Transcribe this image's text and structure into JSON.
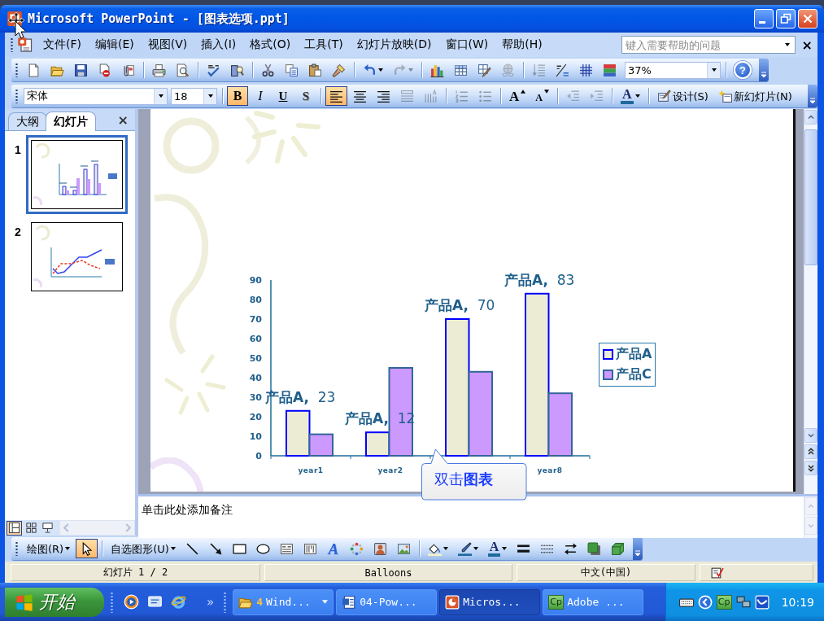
{
  "window": {
    "title": "Microsoft PowerPoint - [图表选项.ppt]"
  },
  "menu_bar": {
    "items": [
      "文件(F)",
      "编辑(E)",
      "视图(V)",
      "插入(I)",
      "格式(O)",
      "工具(T)",
      "幻灯片放映(D)",
      "窗口(W)",
      "帮助(H)"
    ],
    "help_box": {
      "placeholder": "键入需要帮助的问题"
    },
    "close": "×"
  },
  "standard_toolbar": {
    "groups": [
      [
        {
          "kind": "new",
          "disabled": false
        },
        {
          "kind": "open",
          "disabled": false
        },
        {
          "kind": "save",
          "disabled": false
        },
        {
          "kind": "permission",
          "disabled": false
        },
        {
          "kind": "email",
          "disabled": false
        }
      ],
      [
        {
          "kind": "print",
          "disabled": false
        },
        {
          "kind": "preview",
          "disabled": false
        }
      ],
      [
        {
          "kind": "spelling",
          "disabled": false
        },
        {
          "kind": "research",
          "disabled": false
        }
      ],
      [
        {
          "kind": "cut",
          "disabled": false
        },
        {
          "kind": "copy",
          "disabled": false
        },
        {
          "kind": "paste",
          "disabled": false
        },
        {
          "kind": "painter",
          "disabled": false
        }
      ],
      [
        {
          "kind": "undo",
          "disabled": false,
          "dropdown": true
        },
        {
          "kind": "redo",
          "disabled": true,
          "dropdown": true
        }
      ],
      [
        {
          "kind": "chart",
          "disabled": false
        },
        {
          "kind": "table",
          "disabled": false
        },
        {
          "kind": "tables_borders",
          "disabled": false
        },
        {
          "kind": "hyperlink",
          "disabled": true
        }
      ],
      [
        {
          "kind": "expand",
          "disabled": true
        },
        {
          "kind": "formatting",
          "disabled": false
        },
        {
          "kind": "grid",
          "disabled": false
        },
        {
          "kind": "color",
          "disabled": false
        }
      ]
    ],
    "zoom": "37%",
    "help": "?"
  },
  "formatting_toolbar": {
    "font": "宋体",
    "size": "18",
    "groups": [
      [
        {
          "kind": "bold",
          "label": "B",
          "selected": true,
          "disabled": false
        },
        {
          "kind": "italic",
          "label": "I",
          "selected": false,
          "disabled": false
        },
        {
          "kind": "underline",
          "label": "U",
          "selected": false,
          "disabled": false
        },
        {
          "kind": "shadow",
          "label": "S",
          "selected": false,
          "disabled": false
        }
      ],
      [
        {
          "kind": "align_left",
          "selected": true,
          "disabled": false
        },
        {
          "kind": "center",
          "selected": false,
          "disabled": false
        },
        {
          "kind": "align_right",
          "selected": false,
          "disabled": false
        },
        {
          "kind": "justify",
          "selected": false,
          "disabled": true
        },
        {
          "kind": "distributed",
          "selected": false,
          "disabled": true
        }
      ],
      [
        {
          "kind": "numbering",
          "selected": false,
          "disabled": true
        },
        {
          "kind": "bullets",
          "selected": false,
          "disabled": true
        }
      ],
      [
        {
          "kind": "grow",
          "label": "A",
          "selected": false,
          "disabled": false
        },
        {
          "kind": "shrink",
          "label": "A",
          "selected": false,
          "disabled": false
        }
      ],
      [
        {
          "kind": "outdent",
          "selected": false,
          "disabled": true
        },
        {
          "kind": "indent",
          "selected": false,
          "disabled": true
        }
      ],
      [
        {
          "kind": "font_color",
          "label": "A",
          "selected": false,
          "disabled": false,
          "dropdown": true
        }
      ],
      [
        {
          "kind": "design",
          "label": "设计(S)",
          "selected": false,
          "disabled": false
        },
        {
          "kind": "new_slide",
          "label": "新幻灯片(N)",
          "selected": false,
          "disabled": false
        }
      ]
    ]
  },
  "outline_panel": {
    "tabs": [
      {
        "label": "大纲",
        "selected": false
      },
      {
        "label": "幻灯片",
        "selected": true
      }
    ],
    "close": "×",
    "slides": [
      {
        "number": "1",
        "kind": "bar",
        "selected": true
      },
      {
        "number": "2",
        "kind": "line",
        "selected": false
      }
    ],
    "views": [
      {
        "kind": "normal",
        "selected": true
      },
      {
        "kind": "sorter",
        "selected": false
      },
      {
        "kind": "show",
        "selected": false
      }
    ]
  },
  "slide": {
    "chart_data": {
      "type": "bar",
      "categories": [
        "year1",
        "year2",
        null,
        "year8"
      ],
      "series": [
        {
          "name": "产品A",
          "color": "#ececd4",
          "values": [
            23,
            12,
            70,
            83
          ],
          "value_labels": [
            "**产品A,**  23",
            "**产品A,**  12",
            "**产品A,**  70",
            "**产品A,**  83"
          ]
        },
        {
          "name": "产品C",
          "color": "#cc99ff",
          "values": [
            11,
            45,
            43,
            32
          ]
        }
      ],
      "ylim": [
        0,
        90
      ],
      "yticks": [
        0,
        10,
        20,
        30,
        40,
        50,
        60,
        70,
        80,
        90
      ],
      "legend": true
    },
    "callout": "双击**图表**"
  },
  "notes": {
    "placeholder": "单击此处添加备注"
  },
  "drawing_toolbar": {
    "groups": [
      [
        {
          "kind": "draw_menu",
          "label": "绘图(R)",
          "dropdown": true,
          "selected": false
        },
        {
          "kind": "pointer",
          "selected": true
        }
      ],
      [
        {
          "kind": "autoshapes",
          "label": "自选图形(U)",
          "dropdown": true,
          "selected": false
        },
        {
          "kind": "line",
          "selected": false
        },
        {
          "kind": "arrow",
          "selected": false
        },
        {
          "kind": "rectangle",
          "selected": false
        },
        {
          "kind": "oval",
          "selected": false
        },
        {
          "kind": "textbox",
          "selected": false
        },
        {
          "kind": "vertical_textbox",
          "selected": false
        },
        {
          "kind": "wordart",
          "label": "A",
          "selected": false
        },
        {
          "kind": "diagram",
          "selected": false
        },
        {
          "kind": "clipart",
          "selected": false
        },
        {
          "kind": "picture",
          "selected": false
        }
      ],
      [
        {
          "kind": "fill_color",
          "dropdown": true,
          "selected": false
        },
        {
          "kind": "line_color",
          "dropdown": true,
          "selected": false
        },
        {
          "kind": "font_color",
          "label": "A",
          "dropdown": true,
          "selected": false
        },
        {
          "kind": "line_style",
          "selected": false
        },
        {
          "kind": "dash_style",
          "selected": false
        },
        {
          "kind": "arrow_style",
          "selected": false
        },
        {
          "kind": "shadow_box",
          "selected": false
        },
        {
          "kind": "three_d",
          "selected": false
        }
      ]
    ]
  },
  "status_bar": {
    "slide": "幻灯片 1 / 2",
    "design": "Balloons",
    "language": "中文(中国)"
  },
  "taskbar": {
    "start": "开始",
    "quick_launch": [
      {
        "kind": "media"
      },
      {
        "kind": "desktop"
      },
      {
        "kind": "browser"
      }
    ],
    "overflow": "»",
    "tasks": [
      {
        "kind": "folder",
        "count": "4",
        "label": "Wind...",
        "selected": false,
        "dropdown": true
      },
      {
        "kind": "word",
        "label": "04-Pow...",
        "selected": false
      },
      {
        "kind": "powerpoint",
        "label": "Micros...",
        "selected": true
      },
      {
        "kind": "captivate",
        "icon_text": "Cp",
        "label": "Adobe ...",
        "selected": false
      }
    ],
    "tray": {
      "icons": [
        {
          "kind": "keyboard"
        },
        {
          "kind": "back"
        },
        {
          "kind": "captivate",
          "icon_text": "Cp"
        },
        {
          "kind": "network"
        },
        {
          "kind": "swoosh"
        }
      ],
      "time": "10:19"
    }
  }
}
